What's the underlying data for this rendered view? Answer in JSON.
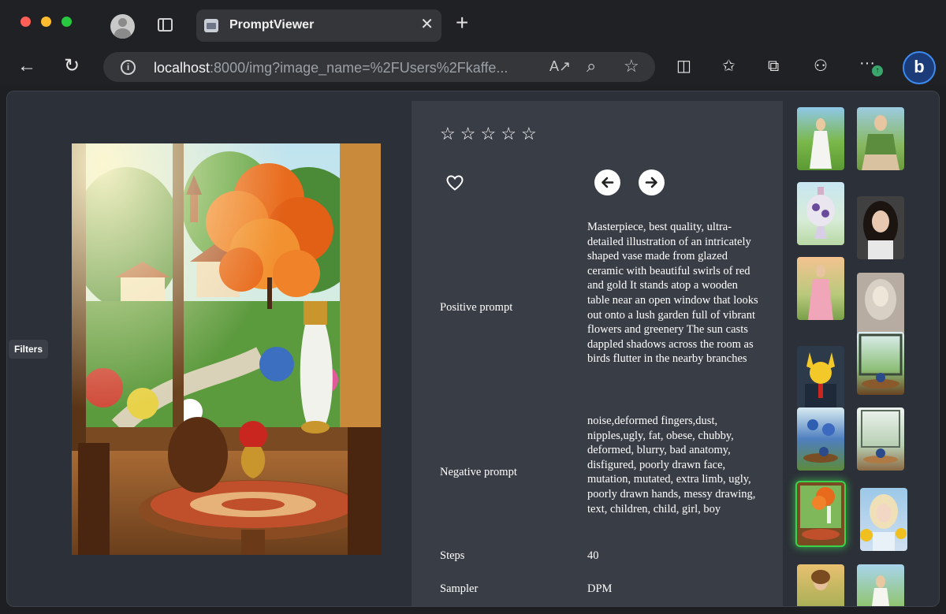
{
  "browser": {
    "tab_title": "PromptViewer",
    "tab_close": "✕",
    "new_tab": "+",
    "url_host": "localhost",
    "url_rest": ":8000/img?image_name=%2FUsers%2Fkaffe...",
    "info_icon": "i",
    "back_icon": "←",
    "reload_icon": "↻",
    "read_aloud_icon": "A↗",
    "zoom_icon": "⌕",
    "favorite_add_icon": "☆",
    "split_icon": "◫",
    "favorites_icon": "✩",
    "collections_icon": "⧉",
    "share_icon": "⚇",
    "more_icon": "···",
    "update_badge": "↑",
    "bing_label": "b"
  },
  "sidebar": {
    "filters_label": "Filters"
  },
  "viewer": {
    "rating": {
      "max": 5,
      "value": 0
    },
    "star_glyph": "☆",
    "favorite": false,
    "fields": {
      "positive_label": "Positive prompt",
      "positive_value": "Masterpiece, best quality, ultra-detailed illustration of an intricately shaped vase made from glazed ceramic with beautiful swirls of red and gold It stands atop a wooden table near an open window that looks out onto a lush garden full of vibrant flowers and greenery The sun casts dappled shadows across the room as birds flutter in the nearby branches",
      "negative_label": "Negative prompt",
      "negative_value": "noise,deformed fingers,dust, nipples,ugly, fat, obese, chubby, deformed, blurry, bad anatomy, disfigured, poorly drawn face, mutation, mutated, extra limb, ugly, poorly drawn hands, messy drawing, text, children, child, girl, boy",
      "steps_label": "Steps",
      "steps_value": "40",
      "sampler_label": "Sampler",
      "sampler_value": "DPM"
    }
  },
  "thumbnails": [
    {
      "name": "woman-white-dress-meadow",
      "selected": false
    },
    {
      "name": "woman-green-top-sitting",
      "selected": false
    },
    {
      "name": "floral-vase-pastel",
      "selected": false
    },
    {
      "name": "dark-haired-woman-portrait",
      "selected": false
    },
    {
      "name": "woman-pink-dress-sunset",
      "selected": false
    },
    {
      "name": "woman-monochrome-portrait",
      "selected": false
    },
    {
      "name": "pikachu-suit",
      "selected": false
    },
    {
      "name": "window-table-teapot",
      "selected": false
    },
    {
      "name": "blue-flowers-teapot",
      "selected": false
    },
    {
      "name": "window-plants-teapot",
      "selected": false
    },
    {
      "name": "orange-flower-vase-window",
      "selected": true
    },
    {
      "name": "blonde-woman-sunflowers",
      "selected": false
    },
    {
      "name": "woman-field",
      "selected": false
    },
    {
      "name": "woman-green-hills",
      "selected": false
    }
  ]
}
